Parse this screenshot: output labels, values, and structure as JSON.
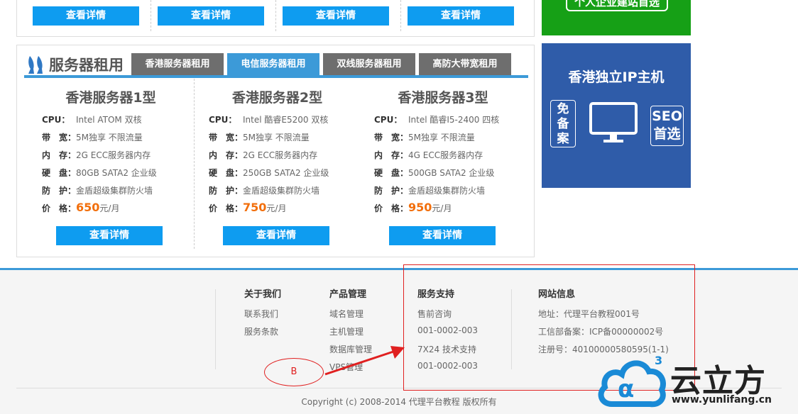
{
  "top_strip": {
    "buttons": [
      "查看详情",
      "查看详情",
      "查看详情",
      "查看详情"
    ]
  },
  "green_ad": {
    "text": "个人企业建站首选"
  },
  "server_panel": {
    "title": "服务器租用",
    "tabs": [
      {
        "label": "香港服务器租用",
        "active": false
      },
      {
        "label": "电信服务器租用",
        "active": true
      },
      {
        "label": "双线服务器租用",
        "active": false
      },
      {
        "label": "高防大带宽租用",
        "active": false
      }
    ],
    "products": [
      {
        "name": "香港服务器1型",
        "cpu_k": "CPU：",
        "cpu": "Intel ATOM 双核",
        "bw_k": "带　宽：",
        "bw": "5M独享 不限流量",
        "mem_k": "内　存：",
        "mem": "2G ECC服务器内存",
        "disk_k": "硬　盘：",
        "disk": "80GB SATA2 企业级",
        "prot_k": "防　护：",
        "prot": "金盾超级集群防火墙",
        "price_k": "价　格：",
        "price": "650",
        "unit": "元/月",
        "button": "查看详情"
      },
      {
        "name": "香港服务器2型",
        "cpu_k": "CPU：",
        "cpu": "Intel 酷睿E5200 双核",
        "bw_k": "带　宽：",
        "bw": "5M独享 不限流量",
        "mem_k": "内　存：",
        "mem": "2G ECC服务器内存",
        "disk_k": "硬　盘：",
        "disk": "250GB SATA2 企业级",
        "prot_k": "防　护：",
        "prot": "金盾超级集群防火墙",
        "price_k": "价　格：",
        "price": "750",
        "unit": "元/月",
        "button": "查看详情"
      },
      {
        "name": "香港服务器3型",
        "cpu_k": "CPU：",
        "cpu": "Intel 酷睿I5-2400 四核",
        "bw_k": "带　宽：",
        "bw": "5M独享 不限流量",
        "mem_k": "内　存：",
        "mem": "4G ECC服务器内存",
        "disk_k": "硬　盘：",
        "disk": "500GB SATA2 企业级",
        "prot_k": "防　护：",
        "prot": "金盾超级集群防火墙",
        "price_k": "价　格：",
        "price": "950",
        "unit": "元/月",
        "button": "查看详情"
      }
    ]
  },
  "blue_ad": {
    "title": "香港独立IP主机",
    "left_badge": [
      "免",
      "备",
      "案"
    ],
    "right_badge": [
      "SEO",
      "首选"
    ]
  },
  "footer": {
    "about": {
      "title": "关于我们",
      "links": [
        "联系我们",
        "服务条款"
      ]
    },
    "products": {
      "title": "产品管理",
      "links": [
        "域名管理",
        "主机管理",
        "数据库管理",
        "VPS管理"
      ]
    },
    "support": {
      "title": "服务支持",
      "links": [
        "售前咨询",
        "001-0002-003",
        "7X24 技术支持",
        "001-0002-003"
      ]
    },
    "site": {
      "title": "网站信息",
      "lines": [
        "地址：代理平台教程001号",
        "工信部备案：ICP备00000002号",
        "注册号：40100000580595(1-1)"
      ]
    },
    "copyright": "Copyright (c) 2008-2014 代理平台教程 版权所有"
  },
  "annotation": {
    "label": "B"
  },
  "brand": {
    "name": "云立方",
    "url": "www.yunlifang.cn",
    "superscript": "3"
  },
  "colors": {
    "accent": "#3c9ad8",
    "button": "#0e9cf0",
    "price": "#f26f0c",
    "annotation": "#e02020"
  }
}
